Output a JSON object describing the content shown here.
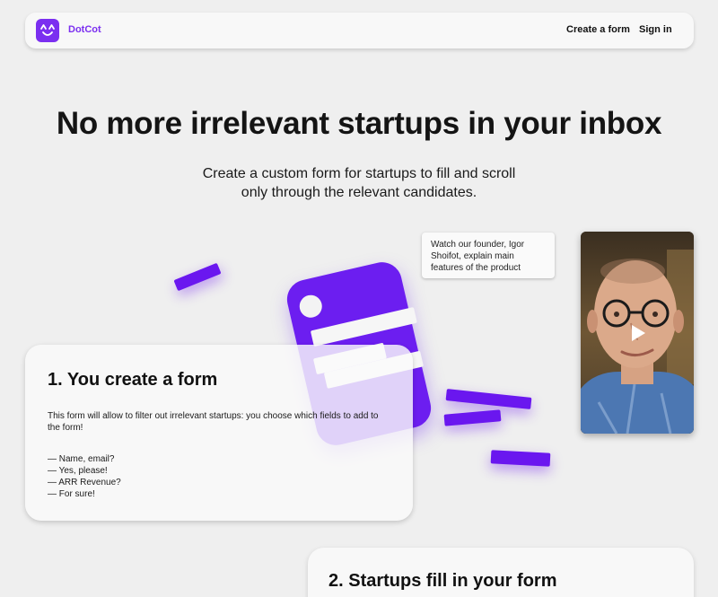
{
  "nav": {
    "brand": "DotCot",
    "create_form": "Create a form",
    "sign_in": "Sign in"
  },
  "hero": {
    "title": "No more irrelevant startups in your inbox",
    "subtitle_line1": "Create a custom form for startups to fill and scroll",
    "subtitle_line2": "only through the relevant candidates."
  },
  "video": {
    "caption": "Watch our founder, Igor Shoifot, explain main features of the product"
  },
  "step1": {
    "title": "1. You create a form",
    "description": "This form will allow to filter out irrelevant startups: you choose which fields to add to the form!",
    "items": [
      "— Name, email?",
      "— Yes, please!",
      "— ARR Revenue?",
      "— For sure!"
    ]
  },
  "step2": {
    "title": "2. Startups fill in your form"
  },
  "colors": {
    "brand": "#7b2ff0",
    "accent_purple": "#6a17ef",
    "background": "#efefef"
  }
}
